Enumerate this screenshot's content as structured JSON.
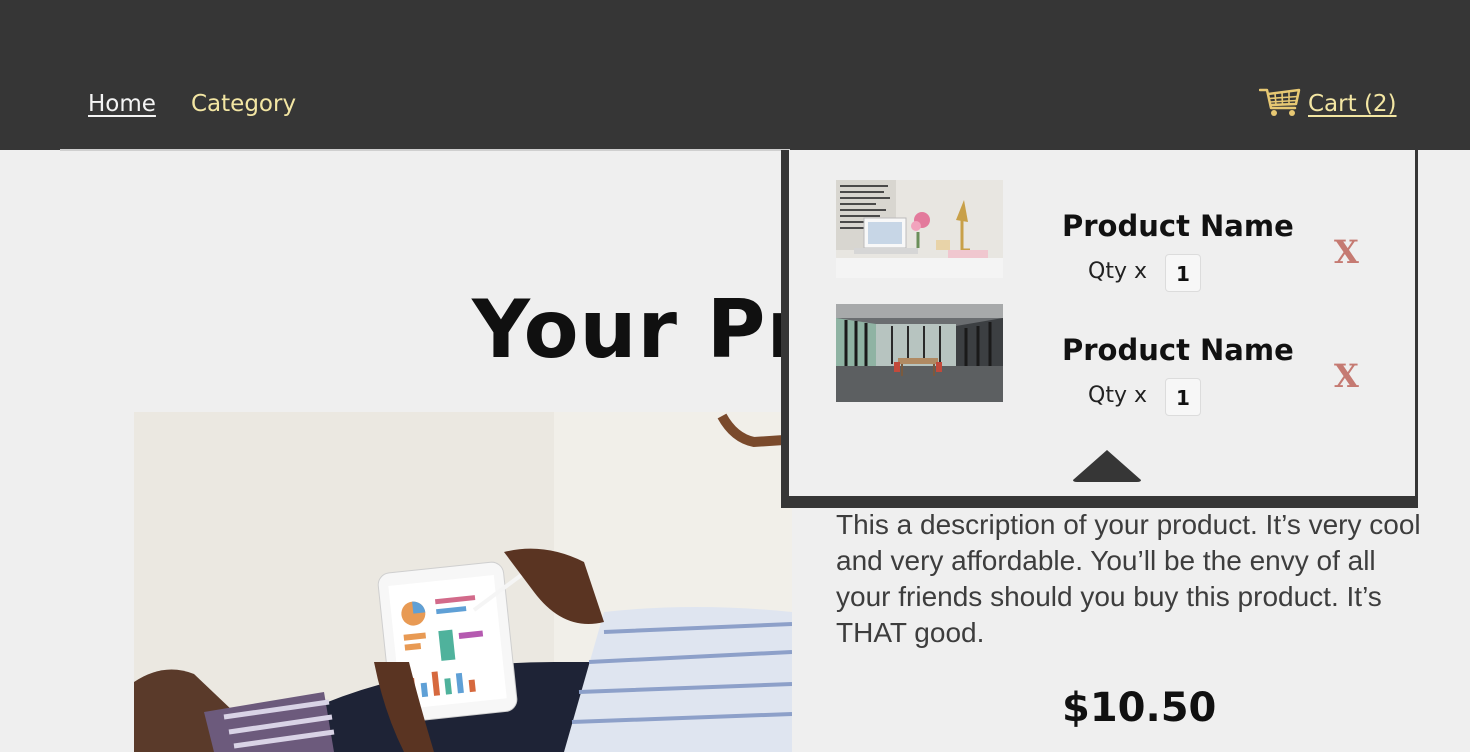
{
  "nav": {
    "home_label": "Home",
    "category_label": "Category",
    "cart_label": "Cart (2)",
    "cart_icon": "shopping-cart-icon"
  },
  "colors": {
    "header_bg": "#363636",
    "nav_link": "#f3e6a3",
    "remove_x": "#c57a72",
    "page_bg": "#efefef"
  },
  "product": {
    "title": "Your Pro",
    "description": "This a description of your product. It’s very cool and very affordable. You’ll be the envy of all your friends should you buy this product. It’s THAT good.",
    "price": "$10.50"
  },
  "cart": {
    "items": [
      {
        "name": "Product Name",
        "qty_label": "Qty x",
        "qty": "1",
        "remove_label": "X"
      },
      {
        "name": "Product Name",
        "qty_label": "Qty x",
        "qty": "1",
        "remove_label": "X"
      }
    ],
    "collapse_icon": "triangle-up-icon"
  }
}
